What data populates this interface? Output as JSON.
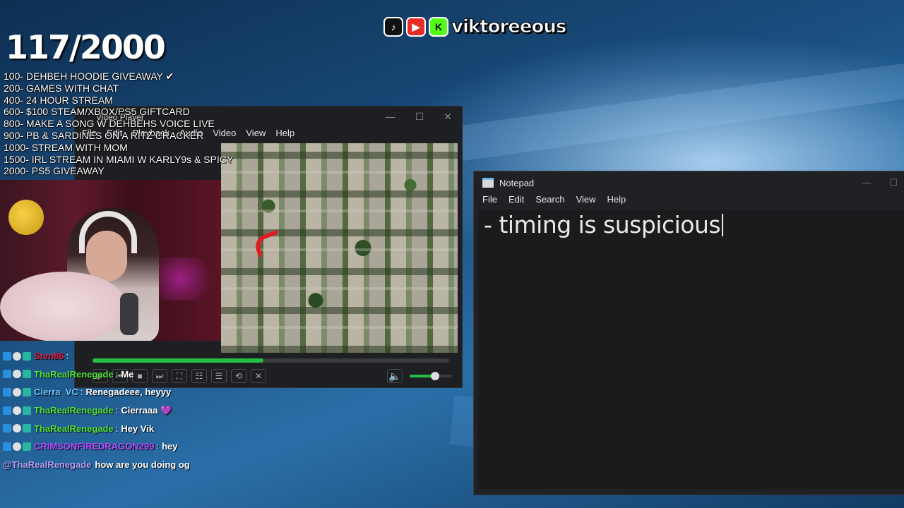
{
  "brand": {
    "tiktok_icon": "tiktok-icon",
    "youtube_icon": "youtube-icon",
    "kick_icon": "kick-icon",
    "kick_glyph": "K",
    "name": "viktoreeous"
  },
  "goals": {
    "counter": "117/2000",
    "items": [
      "100- DEHBEH HOODIE GIVEAWAY ✔",
      "200- GAMES WITH CHAT",
      "400- 24 HOUR STREAM",
      "600- $100 STEAM/XBOX/PS5 GIFTCARD",
      "800- MAKE A SONG W DEHBEHS VOICE LIVE",
      "900- PB & SARDINES ON A RITZ CRACKER",
      "1000- STREAM WITH MOM",
      "1500- IRL STREAM IN MIAMI W KARLY9s & SPICY",
      "2000- PS5 GIVEAWAY"
    ]
  },
  "video_player": {
    "title": "Video Player",
    "menu": [
      "File",
      "Edit",
      "Playback",
      "Audio",
      "Video",
      "View",
      "Help"
    ],
    "progress_fraction": 0.48,
    "volume_fraction": 0.6,
    "colors": {
      "accent": "#23c043"
    }
  },
  "chat": {
    "messages": [
      {
        "user": "Stvn86",
        "color": "#e01c3a",
        "text": ""
      },
      {
        "user": "ThaRealRenegade",
        "color": "#53e23b",
        "text": "Me"
      },
      {
        "user": "Cierra_VC",
        "color": "#6ec7ff",
        "text": "Renegadeee, heyyy"
      },
      {
        "user": "ThaRealRenegade",
        "color": "#53e23b",
        "text": "Cierraaa 💜"
      },
      {
        "user": "ThaRealRenegade",
        "color": "#53e23b",
        "text": "Hey Vik"
      },
      {
        "user": "CRIMSONFiREDRAGON299",
        "color": "#b44cff",
        "text": "hey"
      }
    ],
    "reply": {
      "mention": "@ThaRealRenegade",
      "text": "how are you doing og"
    }
  },
  "notepad": {
    "title": "Notepad",
    "menu": [
      "File",
      "Edit",
      "Search",
      "View",
      "Help"
    ],
    "content": "- timing is suspicious"
  }
}
